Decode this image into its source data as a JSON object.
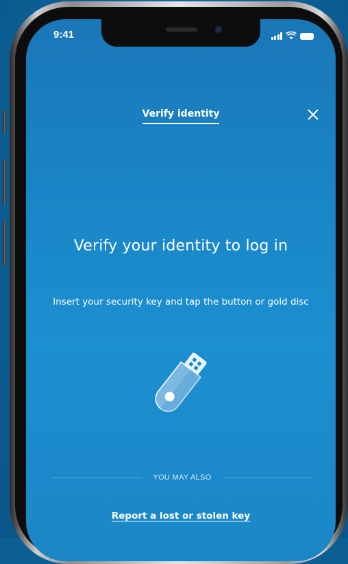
{
  "status_bar": {
    "time": "9:41"
  },
  "header": {
    "title": "Verify identity",
    "close_icon": "close-icon"
  },
  "main": {
    "headline": "Verify your identity to log in",
    "instructions": "Insert your security key and tap the button or gold disc",
    "illustration_icon": "usb-security-key-icon"
  },
  "alternatives": {
    "section_label": "YOU MAY ALSO",
    "report_link": "Report a lost or stolen key"
  },
  "colors": {
    "background": "#0b5f95",
    "screen": "#1986c7",
    "text": "#ffffff"
  }
}
